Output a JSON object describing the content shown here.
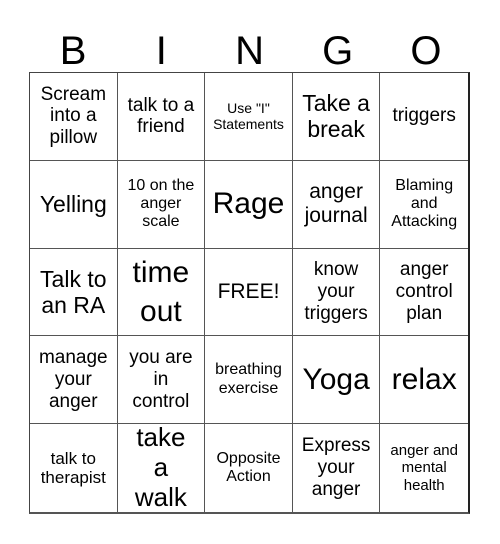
{
  "header": {
    "letters": [
      "B",
      "I",
      "N",
      "G",
      "O"
    ]
  },
  "cells": [
    {
      "text": "Scream into a pillow"
    },
    {
      "text": "talk to a friend"
    },
    {
      "text": "Use \"I\" Statements"
    },
    {
      "text": "Take a break"
    },
    {
      "text": "triggers"
    },
    {
      "text": "Yelling"
    },
    {
      "text": "10 on the anger scale"
    },
    {
      "text": "Rage"
    },
    {
      "text": "anger journal"
    },
    {
      "text": "Blaming and Attacking"
    },
    {
      "text": "Talk to an RA"
    },
    {
      "text": "time out"
    },
    {
      "text": "FREE!"
    },
    {
      "text": "know your triggers"
    },
    {
      "text": "anger control plan"
    },
    {
      "text": "manage your anger"
    },
    {
      "text": "you are in control"
    },
    {
      "text": "breathing exercise"
    },
    {
      "text": "Yoga"
    },
    {
      "text": "relax"
    },
    {
      "text": "talk to therapist"
    },
    {
      "text": "take a walk"
    },
    {
      "text": "Opposite Action"
    },
    {
      "text": "Express your anger"
    },
    {
      "text": "anger and mental health"
    }
  ]
}
